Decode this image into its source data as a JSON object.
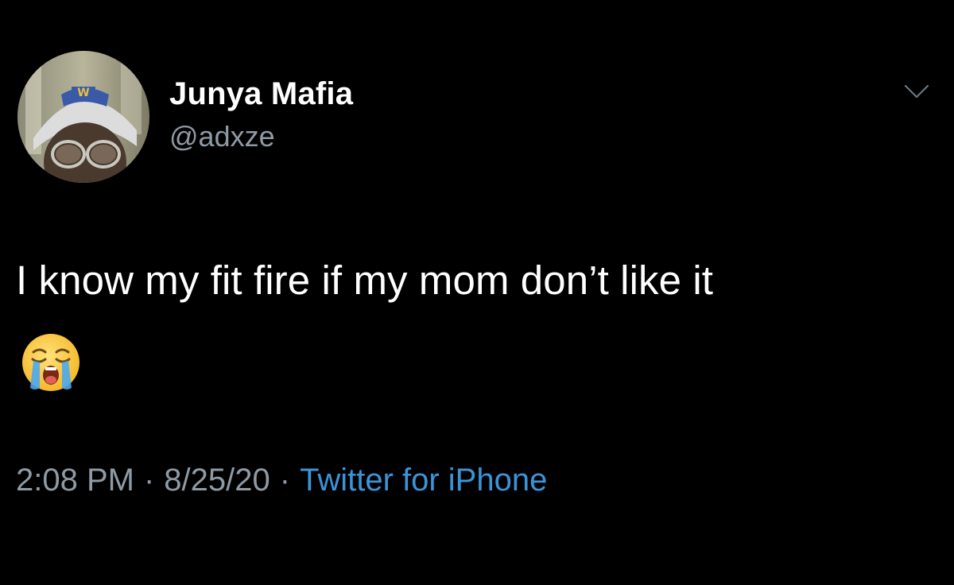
{
  "tweet": {
    "display_name": "Junya Mafia",
    "handle": "@adxze",
    "text": "I know my fit fire if my mom don’t like it",
    "emoji": "😭",
    "emoji_name": "loudly-crying-face",
    "time": "2:08 PM",
    "separator": "·",
    "date": "8/25/20",
    "source": "Twitter for iPhone",
    "menu_icon": "chevron-down-icon"
  },
  "colors": {
    "background": "#000000",
    "text": "#ffffff",
    "muted": "#8e9aa5",
    "link": "#3b94d9"
  }
}
